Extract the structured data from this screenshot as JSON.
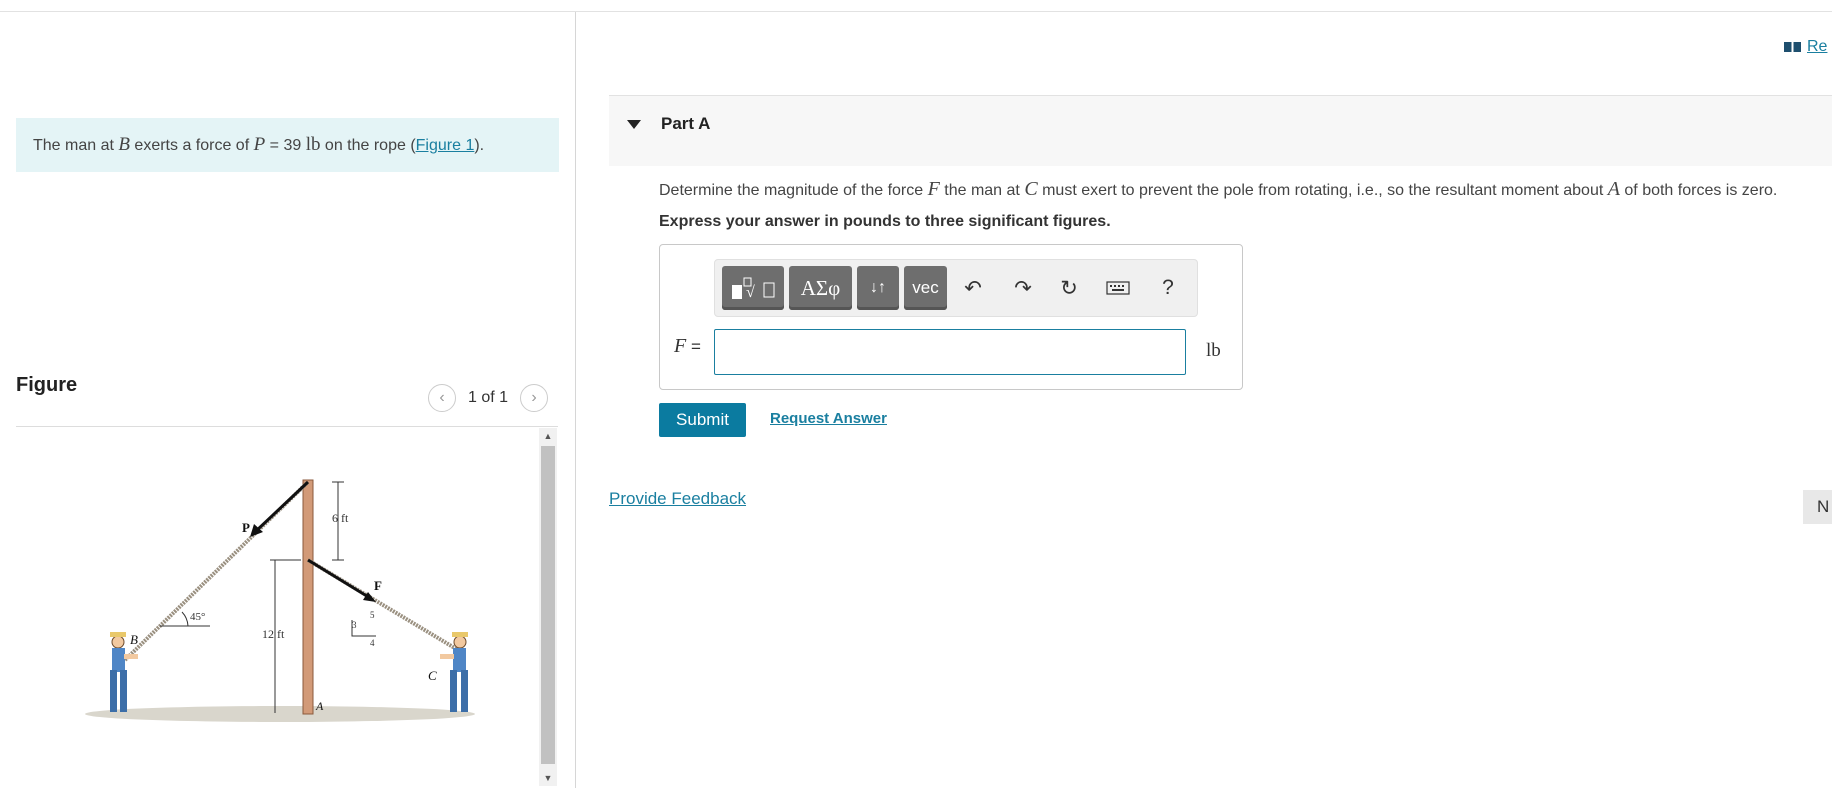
{
  "header": {
    "review_label": "Re"
  },
  "problem": {
    "intro_prefix": "The man at ",
    "intro_var_b": "B",
    "intro_mid": " exerts a force of ",
    "intro_var_p": "P",
    "intro_eq": " = 39 ",
    "intro_unit": "lb",
    "intro_suffix_before_link": " on the rope (",
    "figure_link": "Figure 1",
    "intro_suffix_after_link": ")."
  },
  "figure": {
    "title": "Figure",
    "counter": "1 of 1",
    "prev_icon": "chevron-left-icon",
    "next_icon": "chevron-right-icon",
    "labels": {
      "p": "P",
      "f": "F",
      "b": "B",
      "c": "C",
      "a": "A",
      "angle": "45°",
      "dim_top": "6 ft",
      "dim_height": "12 ft",
      "slope_3": "3",
      "slope_4": "4",
      "slope_5": "5"
    }
  },
  "part": {
    "label": "Part A",
    "question_prefix": "Determine the magnitude of the force ",
    "question_var_f": "F",
    "question_mid1": " the man at ",
    "question_var_c": "C",
    "question_mid2": " must exert to prevent the pole from rotating, i.e., so the resultant moment about ",
    "question_var_a": "A",
    "question_suffix": " of both forces is zero.",
    "instruction": "Express your answer in pounds to three significant figures."
  },
  "toolbar": {
    "templates_icon": "templates-icon",
    "greek_label": "ΑΣφ",
    "arrows_label": "↓↑",
    "vec_label": "vec",
    "undo_icon": "undo-icon",
    "redo_icon": "redo-icon",
    "reset_icon": "reset-icon",
    "keyboard_icon": "keyboard-icon",
    "help_label": "?"
  },
  "answer": {
    "var_label": "F",
    "equals": " =",
    "value": "",
    "unit": "lb"
  },
  "actions": {
    "submit_label": "Submit",
    "request_label": "Request Answer",
    "feedback_label": "Provide Feedback",
    "next_label": "N"
  },
  "colors": {
    "accent": "#0b7ba0",
    "link": "#1a7fa0",
    "intro_bg": "#e4f4f6"
  }
}
